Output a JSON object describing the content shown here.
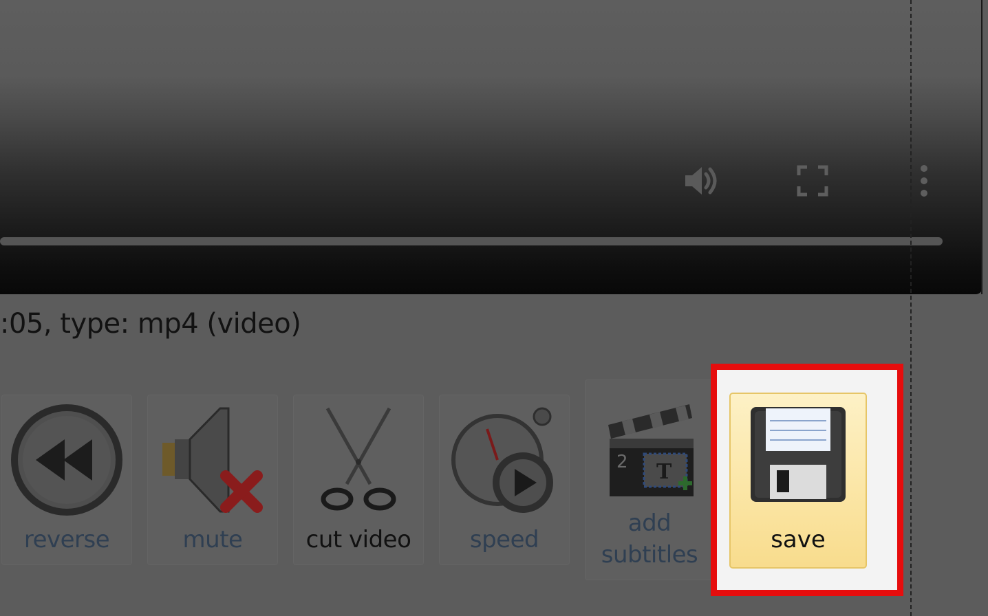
{
  "player": {
    "icons": {
      "volume": "volume-icon",
      "fullscreen": "fullscreen-icon",
      "more": "more-vertical-icon"
    }
  },
  "file_info": {
    "text": ":05, type: mp4 (video)"
  },
  "tools": {
    "reverse": {
      "label": "reverse",
      "icon": "rewind-icon"
    },
    "mute": {
      "label": "mute",
      "icon": "speaker-muted-icon"
    },
    "cut": {
      "label": "cut video",
      "icon": "scissors-icon"
    },
    "speed": {
      "label": "speed",
      "icon": "stopwatch-play-icon"
    },
    "subtitles": {
      "label_line1": "add",
      "label_line2": "subtitles",
      "icon": "clapperboard-text-icon"
    },
    "save": {
      "label": "save",
      "icon": "floppy-disk-icon"
    }
  },
  "colors": {
    "highlight": "#e60d0d",
    "save_bg": "#fbe6a6",
    "overlay": "#5c5c5c"
  }
}
